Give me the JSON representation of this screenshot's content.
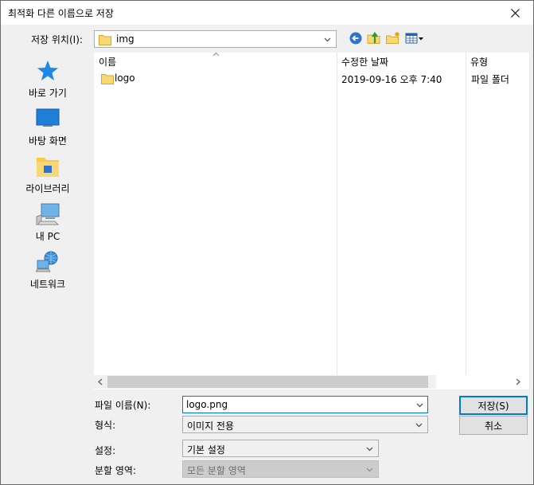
{
  "window": {
    "title": "최적화 다른 이름으로 저장"
  },
  "location": {
    "label": "저장 위치(I):",
    "value": "img"
  },
  "places": [
    {
      "label": "바로 가기",
      "icon": "star-icon"
    },
    {
      "label": "바탕 화면",
      "icon": "desktop-icon"
    },
    {
      "label": "라이브러리",
      "icon": "library-icon"
    },
    {
      "label": "내 PC",
      "icon": "computer-icon"
    },
    {
      "label": "네트워크",
      "icon": "network-icon"
    }
  ],
  "columns": [
    "이름",
    "수정한 날짜",
    "유형"
  ],
  "files": [
    {
      "name": "logo",
      "date": "2019-09-16 오후 7:40",
      "type": "파일 폴더"
    }
  ],
  "form": {
    "filename_label": "파일 이름(N):",
    "filename_value": "logo.png",
    "format_label": "형식:",
    "format_value": "이미지 전용",
    "settings_label": "설정:",
    "settings_value": "기본 설정",
    "slice_label": "분할 영역:",
    "slice_value": "모든 분할 영역"
  },
  "buttons": {
    "save": "저장(S)",
    "cancel": "취소"
  },
  "colors": {
    "accent": "#0078d7",
    "folder": "#f8d775"
  }
}
